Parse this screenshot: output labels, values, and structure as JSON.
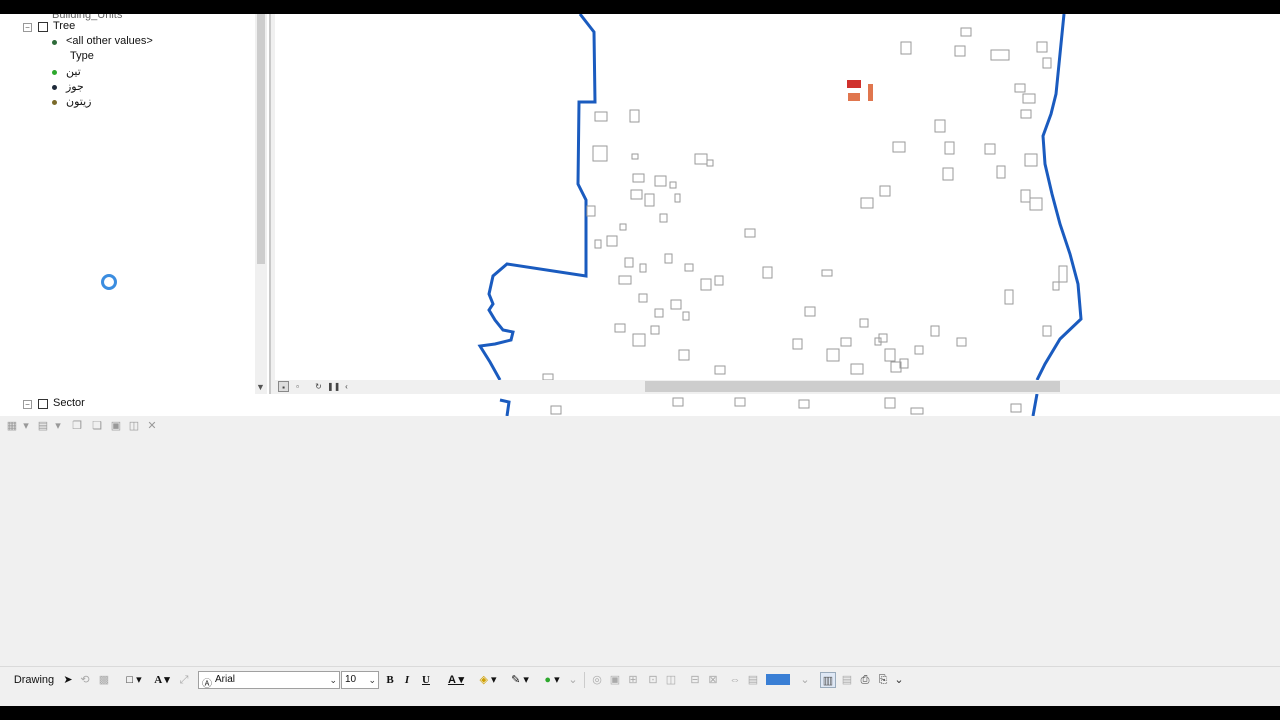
{
  "toc": {
    "cut_top_label": "Building_Units",
    "layers": [
      {
        "name": "Tree"
      },
      {
        "name": "Sector"
      }
    ],
    "tree_legend": {
      "other_values": "<all other values>",
      "field": "Type",
      "classes": [
        {
          "label": "تين",
          "color": "#2da82d"
        },
        {
          "label": "جوز",
          "color": "#1e2a3a"
        },
        {
          "label": "زيتون",
          "color": "#7a6a2a"
        }
      ],
      "other_color": "#2e6b3a"
    }
  },
  "map": {
    "boundary_color": "#1a5bbf",
    "parcel_highlight_colors": [
      "#d0312d",
      "#e0764e"
    ]
  },
  "drawing_toolbar": {
    "menu_label": "Drawing",
    "font_name": "Arial",
    "font_size": "10",
    "bold": "B",
    "italic": "I",
    "underline": "U",
    "font_color_glyph": "A",
    "fill_color": "#3a7fd5"
  }
}
